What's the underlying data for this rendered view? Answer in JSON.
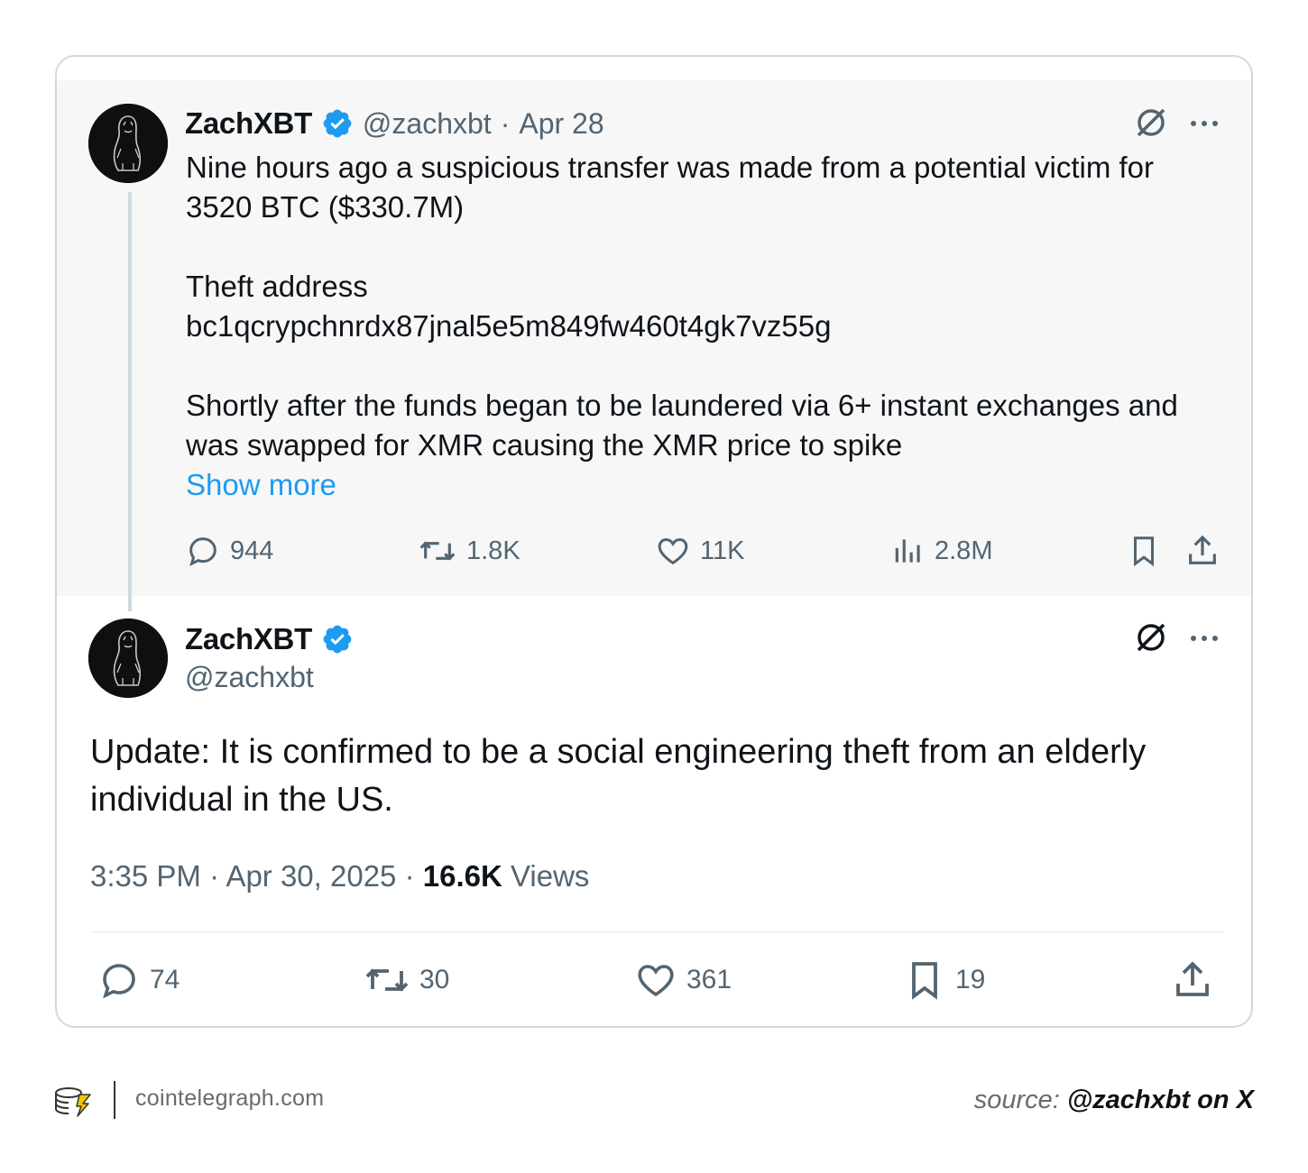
{
  "quoted_tweet": {
    "author_name": "ZachXBT",
    "handle": "@zachxbt",
    "separator": "·",
    "date": "Apr 28",
    "text_lines": {
      "l1": "Nine hours ago a suspicious transfer was made from a potential victim for",
      "l2": "3520 BTC ($330.7M)",
      "l3": "Theft address",
      "l4": "bc1qcrypchnrdx87jnal5e5m849fw460t4gk7vz55g",
      "l5": "Shortly after the funds began to be laundered via 6+ instant exchanges and",
      "l6": "was swapped for XMR causing the XMR price to spike"
    },
    "show_more": "Show more",
    "stats": {
      "replies": "944",
      "reposts": "1.8K",
      "likes": "11K",
      "views": "2.8M"
    }
  },
  "main_tweet": {
    "author_name": "ZachXBT",
    "handle": "@zachxbt",
    "text_line1": "Update: It is confirmed to be a social engineering theft from an elderly",
    "text_line2": "individual in the US.",
    "time": "3:35 PM",
    "separator": "·",
    "date": "Apr 30, 2025",
    "views_count": "16.6K",
    "views_label": "Views",
    "stats": {
      "replies": "74",
      "reposts": "30",
      "likes": "361",
      "bookmarks": "19"
    }
  },
  "footer": {
    "site": "cointelegraph.com",
    "source_prefix": "source:",
    "source_handle": "@zachxbt on X"
  },
  "colors": {
    "verified": "#1d9bf0",
    "link": "#1d9bf0",
    "muted": "#536471",
    "text": "#0f1419"
  },
  "icons": [
    "verified-badge-icon",
    "grok-icon",
    "more-icon",
    "reply-icon",
    "repost-icon",
    "like-icon",
    "views-icon",
    "bookmark-icon",
    "share-icon",
    "cointelegraph-logo-icon"
  ]
}
